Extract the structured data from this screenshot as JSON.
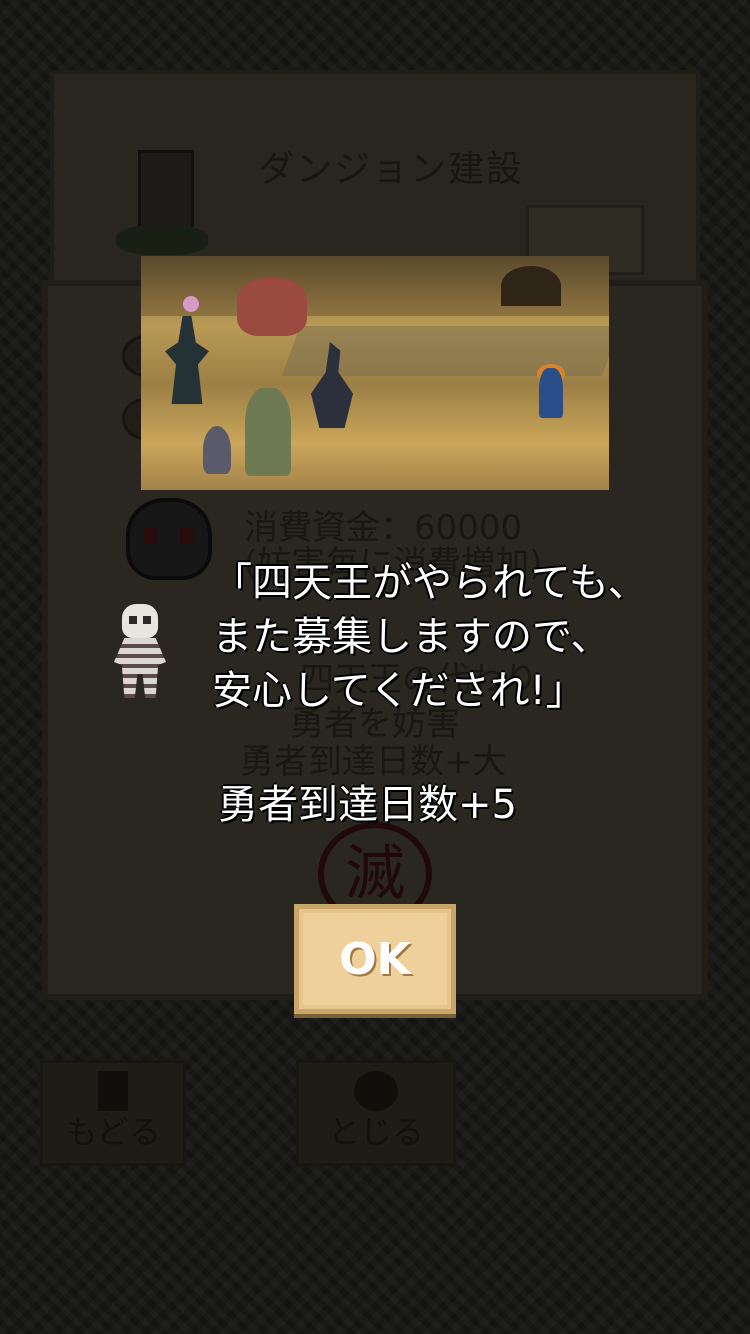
{
  "background": {
    "title": "ダンジョン建設",
    "cost_line": "消費資金：60000",
    "cost_note": "(妨害毎に消費増加)",
    "name_line": "四天王の代わり",
    "desc_line": "勇者を妨害",
    "effect_line": "勇者到達日数+大",
    "back_button_label": "もどる",
    "close_button_label": "とじる"
  },
  "dialog": {
    "message_lines": [
      "「四天王がやられても、",
      "また募集しますので、",
      "安心してくだされ!」"
    ],
    "effect_text": "勇者到達日数+5",
    "ok_label": "OK"
  }
}
